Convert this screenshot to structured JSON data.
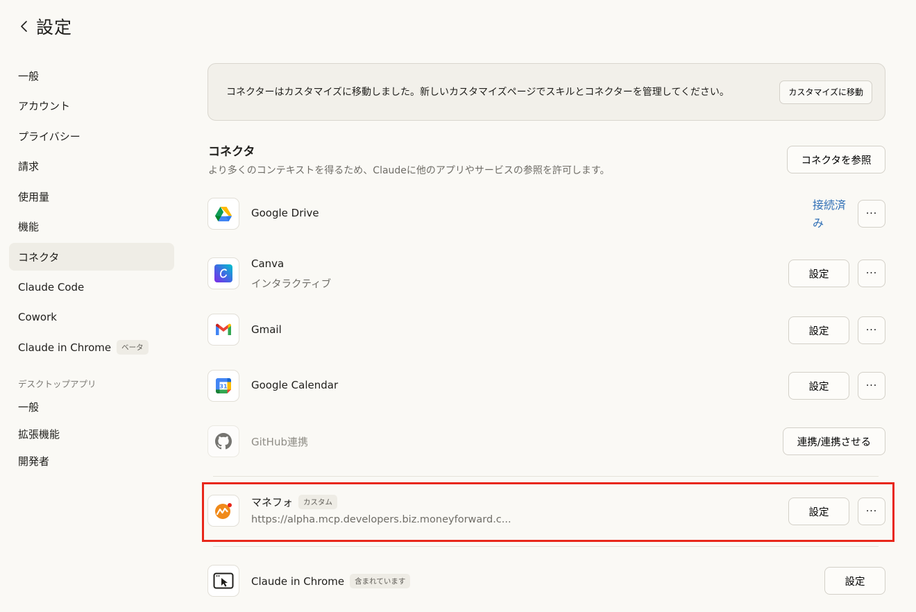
{
  "header": {
    "title": "設定"
  },
  "sidebar": {
    "items": [
      {
        "label": "一般"
      },
      {
        "label": "アカウント"
      },
      {
        "label": "プライバシー"
      },
      {
        "label": "請求"
      },
      {
        "label": "使用量"
      },
      {
        "label": "機能"
      },
      {
        "label": "コネクタ"
      },
      {
        "label": "Claude Code"
      },
      {
        "label": "Cowork"
      },
      {
        "label": "Claude in Chrome",
        "badge": "ベータ"
      }
    ],
    "desktop_section": "デスクトップアプリ",
    "desktop_items": [
      {
        "label": "一般"
      },
      {
        "label": "拡張機能"
      },
      {
        "label": "開発者"
      }
    ]
  },
  "notice": {
    "text": "コネクターはカスタマイズに移動しました。新しいカスタマイズページでスキルとコネクターを管理してください。",
    "button": "カスタマイズに移動"
  },
  "connectors": {
    "title": "コネクタ",
    "description": "より多くのコンテキストを得るため、Claudeに他のアプリやサービスの参照を許可します。",
    "browse_button": "コネクタを参照",
    "items": [
      {
        "name": "Google Drive",
        "status": "接続済み",
        "more": "···"
      },
      {
        "name": "Canva",
        "subtitle": "インタラクティブ",
        "button": "設定",
        "more": "···"
      },
      {
        "name": "Gmail",
        "button": "設定",
        "more": "···"
      },
      {
        "name": "Google Calendar",
        "button": "設定",
        "more": "···"
      },
      {
        "name": "GitHub連携",
        "button": "連携/連携させる"
      },
      {
        "name": "マネフォ",
        "badge": "カスタム",
        "subtitle": "https://alpha.mcp.developers.biz.moneyforward.c...",
        "button": "設定",
        "more": "···"
      },
      {
        "name": "Claude in Chrome",
        "badge": "含まれています",
        "button": "設定"
      }
    ]
  },
  "colors": {
    "highlight": "#e8271b",
    "link": "#2f6fb6",
    "background": "#faf9f5"
  },
  "calendar_icon_number": "31"
}
